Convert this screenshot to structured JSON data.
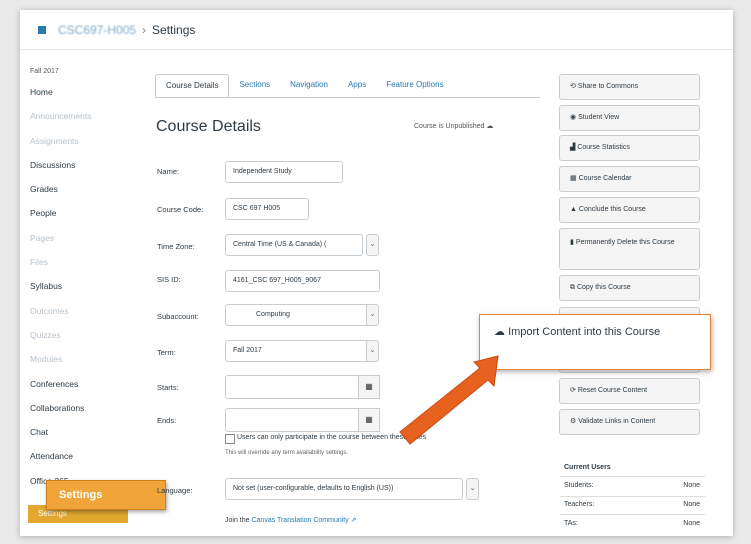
{
  "header": {
    "course_name": "CSC697-H005",
    "separator": "›",
    "page": "Settings"
  },
  "nav": {
    "term": "Fall 2017",
    "items": [
      {
        "label": "Home",
        "dim": false
      },
      {
        "label": "Announcements",
        "dim": true
      },
      {
        "label": "Assignments",
        "dim": true
      },
      {
        "label": "Discussions",
        "dim": false
      },
      {
        "label": "Grades",
        "dim": false
      },
      {
        "label": "People",
        "dim": false
      },
      {
        "label": "Pages",
        "dim": true
      },
      {
        "label": "Files",
        "dim": true
      },
      {
        "label": "Syllabus",
        "dim": false
      },
      {
        "label": "Outcomes",
        "dim": true
      },
      {
        "label": "Quizzes",
        "dim": true
      },
      {
        "label": "Modules",
        "dim": true
      },
      {
        "label": "Conferences",
        "dim": false
      },
      {
        "label": "Collaborations",
        "dim": false
      },
      {
        "label": "Chat",
        "dim": false
      },
      {
        "label": "Attendance",
        "dim": false
      },
      {
        "label": "Office 365",
        "dim": false
      }
    ],
    "active_label": "Settings",
    "callout_label": "Settings"
  },
  "tabs": [
    "Course Details",
    "Sections",
    "Navigation",
    "Apps",
    "Feature Options"
  ],
  "page_title": "Course Details",
  "publish_status": "Course is Unpublished",
  "form": {
    "name_label": "Name:",
    "name_value": "Independent Study",
    "code_label": "Course Code:",
    "code_value": "CSC 697 H005",
    "tz_label": "Time Zone:",
    "tz_value": "Central Time (US & Canada) (",
    "sis_label": "SIS ID:",
    "sis_value": "4161_CSC 697_H005_9067",
    "sub_label": "Subaccount:",
    "sub_value": "Computing",
    "term_label": "Term:",
    "term_value": "Fall 2017",
    "starts_label": "Starts:",
    "ends_label": "Ends:",
    "restrict_text": "Users can only participate in the course between these dates",
    "restrict_note": "This will override any term availability settings.",
    "lang_label": "Language:",
    "lang_value": "Not set (user-configurable, defaults to English (US))",
    "community_prefix": "Join the",
    "community_link": "Canvas Translation Community",
    "community_link_icon": "external-link-icon"
  },
  "sidebar": {
    "buttons": [
      {
        "icon": "share-icon",
        "label": "Share to Commons"
      },
      {
        "icon": "student-view-icon",
        "label": "Student View"
      },
      {
        "icon": "statistics-icon",
        "label": "Course Statistics"
      },
      {
        "icon": "calendar-icon",
        "label": "Course Calendar"
      },
      {
        "icon": "lock-icon",
        "label": "Conclude this Course"
      },
      {
        "icon": "trash-icon",
        "label": "Permanently Delete this Course"
      },
      {
        "icon": "copy-icon",
        "label": "Copy this Course"
      },
      {
        "icon": "reset-icon",
        "label": "Reset Course Content"
      },
      {
        "icon": "validate-icon",
        "label": "Validate Links in Content"
      }
    ],
    "import_callout": "Import Content into this Course",
    "users_title": "Current Users",
    "users": [
      {
        "role": "Students:",
        "count": "None"
      },
      {
        "role": "Teachers:",
        "count": "None"
      },
      {
        "role": "TAs:",
        "count": "None"
      }
    ]
  },
  "colors": {
    "accent": "#2a7ab0",
    "callout_orange": "#f0a43a",
    "arrow_orange": "#e8621f"
  }
}
